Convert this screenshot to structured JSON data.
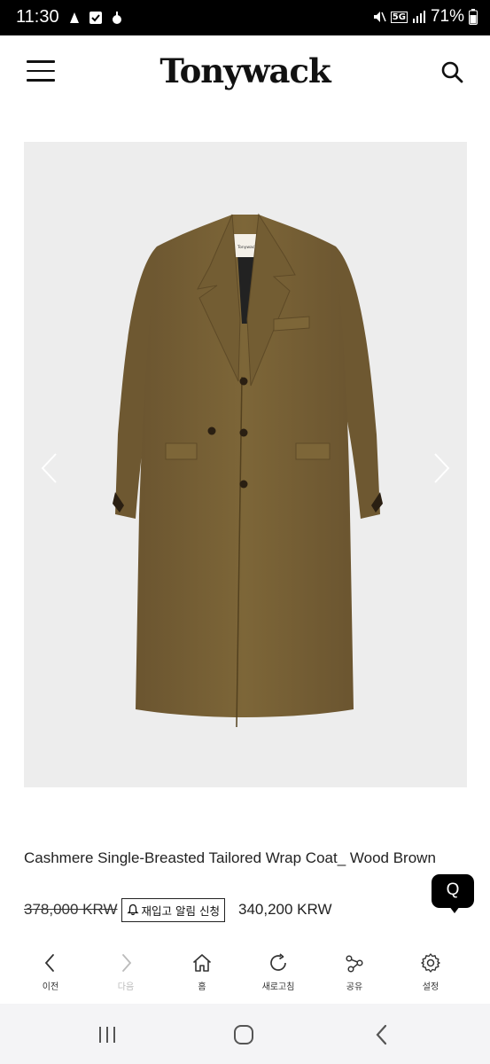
{
  "status_bar": {
    "time": "11:30",
    "network": "5G",
    "battery": "71%"
  },
  "header": {
    "logo": "Tonywack"
  },
  "product": {
    "title": "Cashmere Single-Breasted Tailored Wrap Coat_ Wood Brown",
    "original_price": "378,000 KRW",
    "restock_button": "재입고 알림 신청",
    "sale_price": "340,200 KRW",
    "coat_color": "#7a6336"
  },
  "chat": {
    "label": "Q"
  },
  "browser_toolbar": {
    "items": [
      {
        "label": "이전",
        "icon": "back-icon"
      },
      {
        "label": "다음",
        "icon": "forward-icon"
      },
      {
        "label": "홈",
        "icon": "home-icon"
      },
      {
        "label": "새로고침",
        "icon": "refresh-icon"
      },
      {
        "label": "공유",
        "icon": "share-icon"
      },
      {
        "label": "설정",
        "icon": "settings-icon"
      }
    ]
  }
}
